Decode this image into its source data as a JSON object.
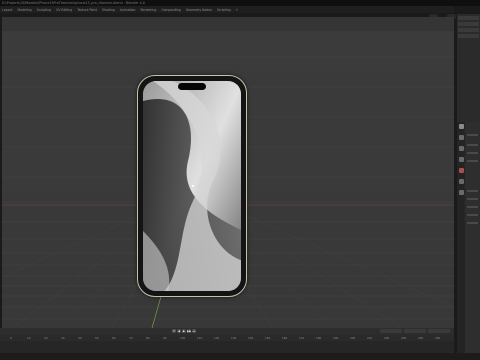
{
  "window": {
    "title": "D:\\Projects\\3DModels\\iPhone15ProTitanium\\iphone15_pro_titanium.blend - Blender 4.0"
  },
  "menu": {
    "items": [
      "Layout",
      "Modeling",
      "Sculpting",
      "UV Editing",
      "Texture Paint",
      "Shading",
      "Animation",
      "Rendering",
      "Compositing",
      "Geometry Nodes",
      "Scripting",
      "+"
    ]
  },
  "timeline": {
    "ticks": [
      "0",
      "10",
      "20",
      "30",
      "40",
      "50",
      "60",
      "70",
      "80",
      "90",
      "100",
      "110",
      "120",
      "130",
      "140",
      "150",
      "160",
      "170",
      "180",
      "190",
      "200",
      "210",
      "220",
      "230",
      "240",
      "250"
    ],
    "controls": [
      "⏮",
      "◀",
      "▶",
      "▶▶",
      "⏭"
    ]
  },
  "phone": {
    "model": "iPhone 15 Pro",
    "wallpaper_color": "#b8b8b8",
    "frame_color": "#c9c1a6"
  },
  "colors": {
    "viewport_bg": "#3a3a3a",
    "grid_line": "#464646",
    "y_axis": "#7fae3e",
    "x_axis": "#b05050"
  }
}
